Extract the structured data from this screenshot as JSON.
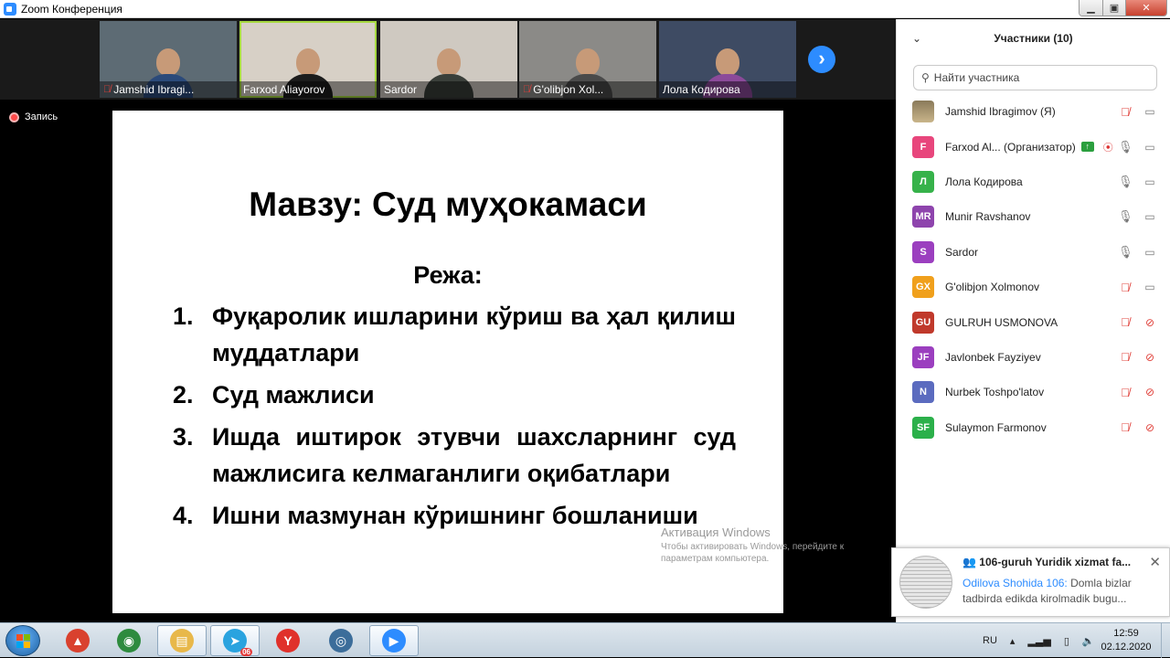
{
  "window": {
    "title": "Zoom Конференция"
  },
  "thumbnails": [
    {
      "name": "Jamshid Ibragi...",
      "muted": true,
      "active": false,
      "bg": "#5d6b74",
      "shirt": "#2b4a7a"
    },
    {
      "name": "Farxod Aliayorov",
      "muted": false,
      "active": true,
      "bg": "#d7d0c6",
      "shirt": "#1c1c1c"
    },
    {
      "name": "Sardor",
      "muted": false,
      "active": false,
      "bg": "#cfc9c1",
      "shirt": "#3a3f3a"
    },
    {
      "name": "G'olibjon Xol...",
      "muted": true,
      "active": false,
      "bg": "#8b8a87",
      "shirt": "#4a4a4a"
    },
    {
      "name": "Лола Кодирова",
      "muted": false,
      "active": false,
      "bg": "#3e4b63",
      "shirt": "#8b4a9a"
    }
  ],
  "recording": {
    "label": "Запись"
  },
  "slide": {
    "title": "Мавзу: Суд муҳокамаси",
    "subtitle": "Режа:",
    "items": [
      {
        "num": "1.",
        "text": "Фуқаролик ишларини кўриш ва ҳал қилиш муддатлари"
      },
      {
        "num": "2.",
        "text": "Суд мажлиси"
      },
      {
        "num": "3.",
        "text": "Ишда иштирок этувчи шахсларнинг суд мажлисига келмаганлиги оқибатлари"
      },
      {
        "num": "4.",
        "text": "Ишни мазмунан кўришнинг бошланиши"
      }
    ]
  },
  "watermark": {
    "title": "Активация Windows",
    "text": "Чтобы активировать Windows, перейдите к параметрам компьютера."
  },
  "participants_panel": {
    "title": "Участники (10)",
    "search_placeholder": "Найти участника",
    "participants": [
      {
        "initials": "",
        "photo": true,
        "color": "#9a8660",
        "name": "Jamshid Ibragimov (Я)",
        "mic_off": true,
        "cam_off": false
      },
      {
        "initials": "F",
        "photo": false,
        "color": "#e8467c",
        "name": "Farxod Al... (Организатор)",
        "host": true,
        "mic_off": false,
        "cam_off": false
      },
      {
        "initials": "Л",
        "photo": false,
        "color": "#36b24a",
        "name": "Лола Кодирова",
        "mic_off": false,
        "cam_off": false
      },
      {
        "initials": "MR",
        "photo": false,
        "color": "#8e44ad",
        "name": "Munir Ravshanov",
        "mic_off": false,
        "cam_off": false
      },
      {
        "initials": "S",
        "photo": false,
        "color": "#9b3fbf",
        "name": "Sardor",
        "mic_off": false,
        "cam_off": false
      },
      {
        "initials": "GX",
        "photo": false,
        "color": "#f0a01c",
        "name": "G'olibjon Xolmonov",
        "mic_off": true,
        "cam_off": false
      },
      {
        "initials": "GU",
        "photo": false,
        "color": "#c0392b",
        "name": "GULRUH USMONOVA",
        "mic_off": true,
        "cam_off": true
      },
      {
        "initials": "JF",
        "photo": false,
        "color": "#9b3fbf",
        "name": "Javlonbek Fayziyev",
        "mic_off": true,
        "cam_off": true
      },
      {
        "initials": "N",
        "photo": false,
        "color": "#5b6bbf",
        "name": "Nurbek Toshpo'latov",
        "mic_off": true,
        "cam_off": true
      },
      {
        "initials": "SF",
        "photo": false,
        "color": "#2bb04a",
        "name": "Sulaymon Farmonov",
        "mic_off": true,
        "cam_off": true
      }
    ]
  },
  "notification": {
    "title": "106-guruh Yuridik xizmat fa...",
    "sender": "Odilova Shohida 106:",
    "message": " Domla bizlar tadbirda edikda kirolmadik bugu..."
  },
  "taskbar": {
    "language": "RU",
    "time": "12:59",
    "date": "02.12.2020",
    "telegram_badge": "06",
    "apps": [
      {
        "name": "winrar-icon",
        "color": "#d9412e",
        "glyph": "▲",
        "on": false
      },
      {
        "name": "chrome-icon",
        "color": "#2e8b3e",
        "glyph": "◉",
        "on": false
      },
      {
        "name": "explorer-icon",
        "color": "#e8b84a",
        "glyph": "▤",
        "on": true
      },
      {
        "name": "telegram-icon",
        "color": "#2aa3df",
        "glyph": "➤",
        "on": true
      },
      {
        "name": "yandex-icon",
        "color": "#e0312b",
        "glyph": "Y",
        "on": false
      },
      {
        "name": "webcam-icon",
        "color": "#3c6d9a",
        "glyph": "◎",
        "on": false
      },
      {
        "name": "zoom-icon",
        "color": "#2d8cff",
        "glyph": "▶",
        "on": true
      }
    ]
  },
  "colors": {
    "zoom_blue": "#2d8cff",
    "muted_red": "#e0403a",
    "active_green": "#a6d940"
  }
}
